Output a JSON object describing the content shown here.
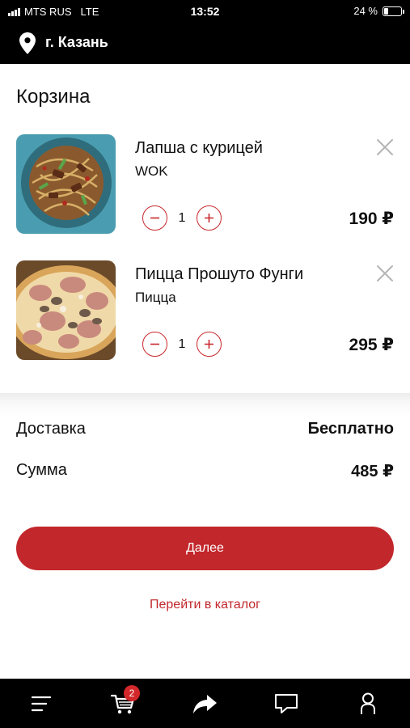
{
  "status_bar": {
    "carrier": "MTS RUS",
    "network": "LTE",
    "time": "13:52",
    "battery_text": "24 %",
    "battery_level": 0.24
  },
  "header": {
    "city": "г. Казань",
    "pin_icon": "location-pin-icon"
  },
  "cart": {
    "title": "Корзина",
    "items": [
      {
        "name": "Лапша с курицей",
        "category": "WOK",
        "quantity": "1",
        "price": "190 ₽",
        "image_icon": "noodles-with-chicken-photo"
      },
      {
        "name": "Пицца Прошуто Фунги",
        "category": "Пицца",
        "quantity": "1",
        "price": "295 ₽",
        "image_icon": "prosciutto-funghi-pizza-photo"
      }
    ]
  },
  "summary": {
    "delivery_label": "Доставка",
    "delivery_value": "Бесплатно",
    "total_label": "Сумма",
    "total_value": "485 ₽"
  },
  "actions": {
    "next_label": "Далее",
    "catalog_link": "Перейти в каталог"
  },
  "bottom_nav": {
    "cart_badge": "2",
    "items": [
      "menu-icon",
      "cart-icon",
      "share-icon",
      "chat-icon",
      "profile-icon"
    ]
  },
  "colors": {
    "accent": "#c2272b",
    "header_bg": "#000000",
    "badge": "#d3282b"
  }
}
